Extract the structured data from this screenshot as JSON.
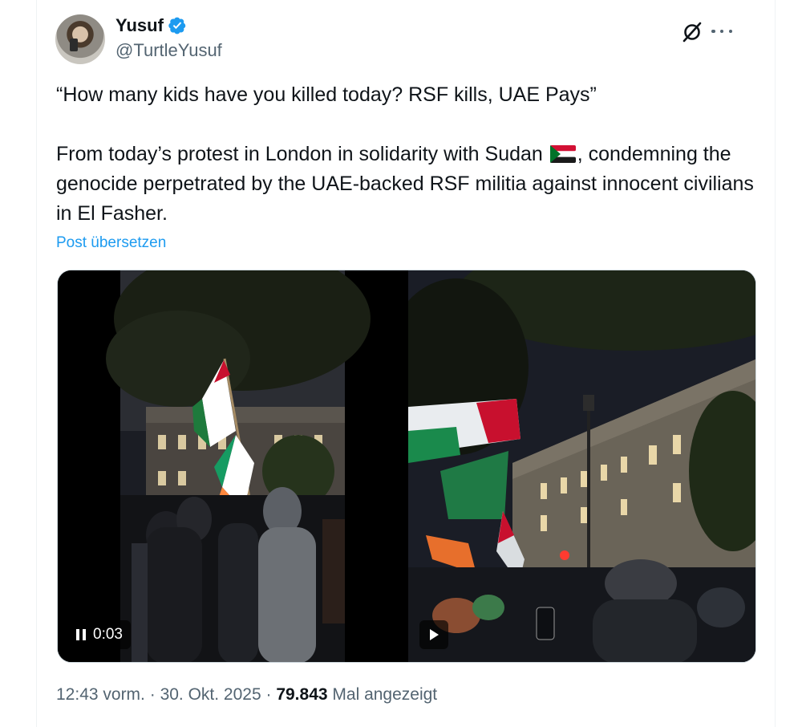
{
  "author": {
    "name": "Yusuf",
    "handle": "@TurtleYusuf",
    "verified": true,
    "verified_color": "#1d9bf0"
  },
  "icons": {
    "grok": "grok-icon",
    "more": "more-options-icon",
    "verified": "verified-badge-icon",
    "pause": "pause-icon",
    "play": "play-icon"
  },
  "tweet": {
    "line1": "“How many kids have you killed today? RSF kills, UAE Pays”",
    "para2_before_flag": "From today’s protest in London in solidarity with Sudan ",
    "para2_after_flag": ", condemning the genocide perpetrated by the UAE-backed RSF militia against innocent civilians in El Fasher.",
    "flag": "sudan-flag-emoji",
    "translate_label": "Post übersetzen"
  },
  "media": {
    "video1": {
      "time": "0:03",
      "state": "playing"
    },
    "video2": {
      "state": "paused"
    }
  },
  "footer": {
    "time": "12:43 vorm.",
    "separator": " · ",
    "date": "30. Okt. 2025",
    "views": "79.843",
    "views_label": " Mal angezeigt"
  },
  "colors": {
    "link": "#1d9bf0",
    "secondary_text": "#536471",
    "primary_text": "#0f1419"
  }
}
